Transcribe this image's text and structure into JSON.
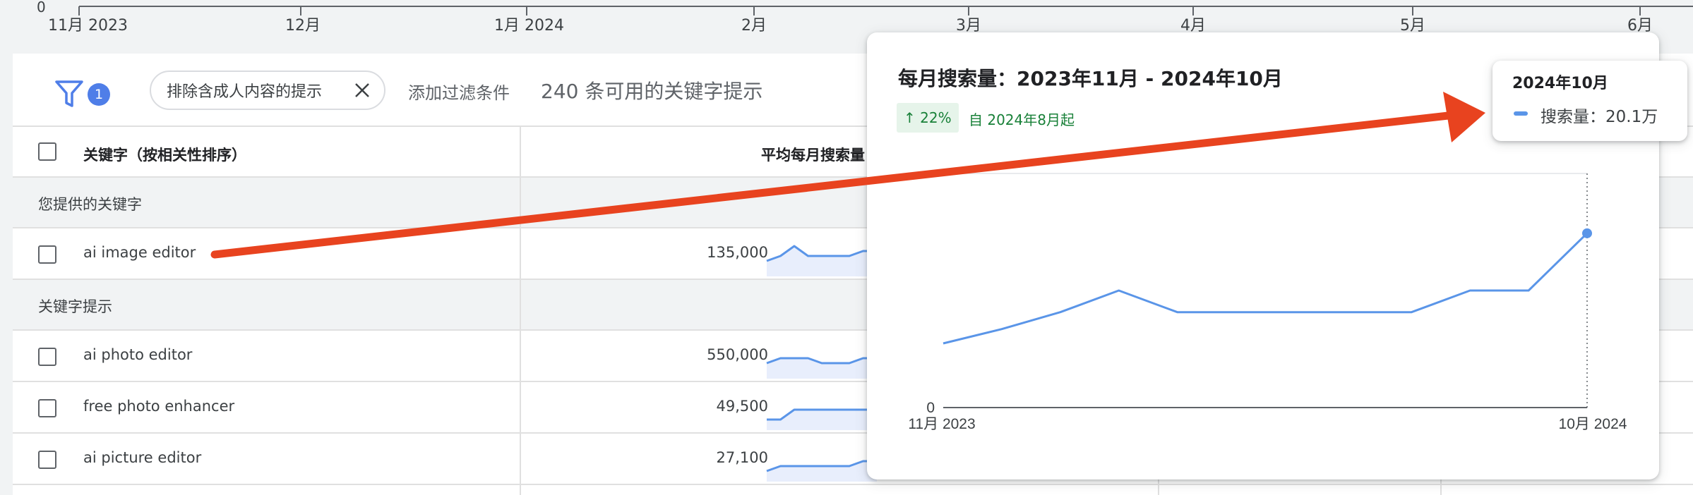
{
  "timeline": {
    "zero_label": "0",
    "months": [
      "11月 2023",
      "12月",
      "1月 2024",
      "2月",
      "3月",
      "4月",
      "5月",
      "6月"
    ]
  },
  "filter_bar": {
    "badge_count": "1",
    "chip_label": "排除含成人内容的提示",
    "add_filter_label": "添加过滤条件",
    "count_text": "240 条可用的关键字提示"
  },
  "table": {
    "headers": {
      "keyword": "关键字（按相关性排序）",
      "avg_monthly": "平均每月搜索量"
    },
    "groups": [
      {
        "label": "您提供的关键字",
        "rows": [
          {
            "keyword": "ai image editor",
            "volume": "135,000",
            "trend": [
              2,
              3,
              5,
              3,
              3,
              3,
              3,
              4,
              4
            ]
          }
        ]
      },
      {
        "label": "关键字提示",
        "rows": [
          {
            "keyword": "ai photo editor",
            "volume": "550,000",
            "trend": [
              2,
              3,
              3,
              3,
              2,
              2,
              2,
              3,
              3
            ]
          },
          {
            "keyword": "free photo enhancer",
            "volume": "49,500",
            "trend": [
              1,
              1,
              3,
              3,
              3,
              3,
              3,
              3,
              3
            ]
          },
          {
            "keyword": "ai picture editor",
            "volume": "27,100",
            "trend": [
              1,
              2,
              2,
              2,
              2,
              2,
              2,
              3,
              3
            ]
          }
        ]
      }
    ]
  },
  "popup": {
    "title": "每月搜索量：2023年11月 - 2024年10月",
    "trend_badge": "↑ 22%",
    "trend_since": "自 2024年8月起"
  },
  "chart_data": {
    "type": "line",
    "title": "每月搜索量：2023年11月 - 2024年10月",
    "x": [
      "2023-11",
      "2023-12",
      "2024-01",
      "2024-02",
      "2024-03",
      "2024-04",
      "2024-05",
      "2024-06",
      "2024-07",
      "2024-08",
      "2024-09",
      "2024-10"
    ],
    "x_tick_labels": [
      "11月 2023",
      "10月 2024"
    ],
    "y_tick_labels": [
      "0"
    ],
    "series": [
      {
        "name": "搜索量",
        "values": [
          74000,
          90500,
          110000,
          135000,
          110000,
          110000,
          110000,
          110000,
          110000,
          135000,
          135000,
          201000
        ]
      }
    ],
    "ylim": [
      0,
      270000
    ],
    "grid": true,
    "color": "#5a95e8"
  },
  "tooltip": {
    "date": "2024年10月",
    "value_text": "搜索量：20.1万"
  },
  "colors": {
    "accent": "#5a95e8",
    "badge": "#4f7ee8",
    "arrow": "#e8431f",
    "trend_green": "#188038"
  },
  "icons": {
    "filter": "filter-icon",
    "close": "close-icon",
    "trend_up": "arrow-up-icon",
    "annotation": "annotation-arrow"
  }
}
